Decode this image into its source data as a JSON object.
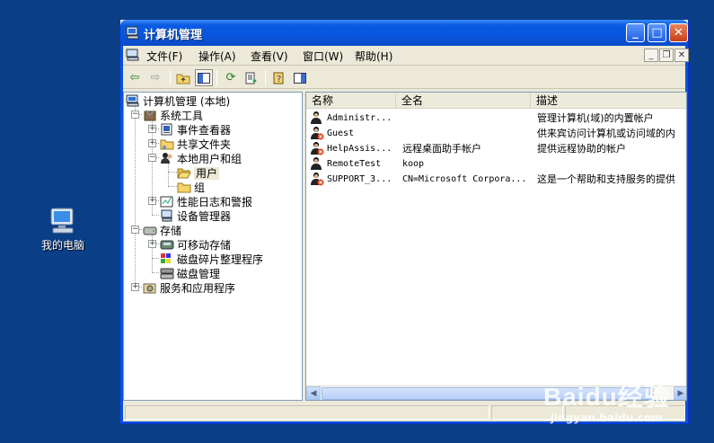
{
  "desktop": {
    "icon_label": "我的电脑"
  },
  "window": {
    "title": "计算机管理",
    "menu": [
      {
        "label": "文件(F)"
      },
      {
        "label": "操作(A)"
      },
      {
        "label": "查看(V)"
      },
      {
        "label": "窗口(W)"
      },
      {
        "label": "帮助(H)"
      }
    ]
  },
  "tree": {
    "root": "计算机管理 (本地)",
    "system_tools": "系统工具",
    "event_viewer": "事件查看器",
    "shared_folders": "共享文件夹",
    "local_users": "本地用户和组",
    "users": "用户",
    "groups": "组",
    "perf_logs": "性能日志和警报",
    "device_manager": "设备管理器",
    "storage": "存储",
    "removable": "可移动存储",
    "defrag": "磁盘碎片整理程序",
    "disk_mgmt": "磁盘管理",
    "services": "服务和应用程序"
  },
  "list": {
    "columns": [
      "名称",
      "全名",
      "描述"
    ],
    "rows": [
      {
        "name": "Administr...",
        "fullname": "",
        "desc": "管理计算机(域)的内置帐户",
        "disabled": false
      },
      {
        "name": "Guest",
        "fullname": "",
        "desc": "供来宾访问计算机或访问域的内",
        "disabled": true
      },
      {
        "name": "HelpAssis...",
        "fullname": "远程桌面助手帐户",
        "desc": "提供远程协助的帐户",
        "disabled": true
      },
      {
        "name": "RemoteTest",
        "fullname": "koop",
        "desc": "",
        "disabled": false
      },
      {
        "name": "SUPPORT_3...",
        "fullname": "CN=Microsoft Corpora...",
        "desc": "这是一个帮助和支持服务的提供",
        "disabled": true
      }
    ]
  },
  "watermark": {
    "brand": "Baidu经验",
    "url": "jingyan.baidu.com"
  }
}
